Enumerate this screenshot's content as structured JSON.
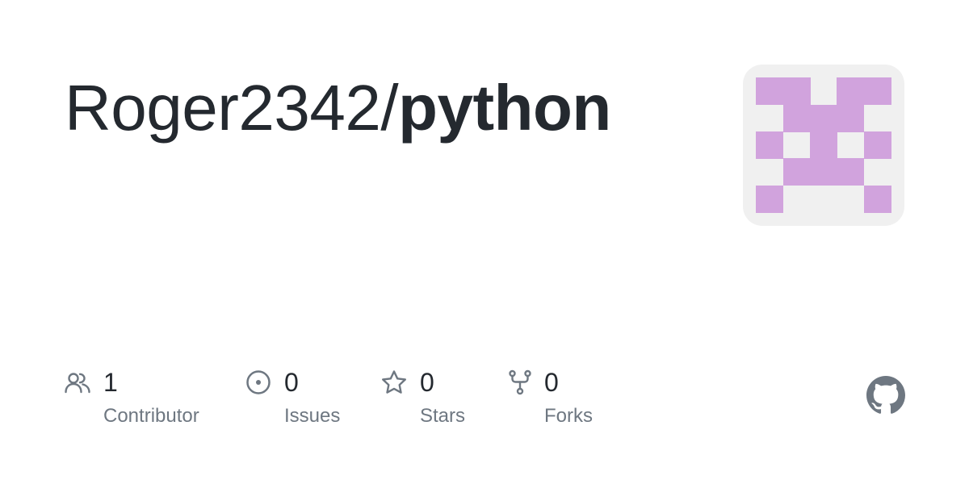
{
  "repo": {
    "owner": "Roger2342/",
    "name": "python"
  },
  "avatar": {
    "background_color": "#f0f0f0",
    "pattern_color": "#d1a3dd",
    "icon": "identicon"
  },
  "stats": [
    {
      "icon": "people-icon",
      "count": "1",
      "label": "Contributor"
    },
    {
      "icon": "issue-opened-icon",
      "count": "0",
      "label": "Issues"
    },
    {
      "icon": "star-icon",
      "count": "0",
      "label": "Stars"
    },
    {
      "icon": "repo-forked-icon",
      "count": "0",
      "label": "Forks"
    }
  ],
  "logo": {
    "icon": "github-mark-icon",
    "color": "#6e7781"
  },
  "colors": {
    "text_primary": "#24292f",
    "text_secondary": "#6e7781",
    "icon": "#6e7781"
  }
}
